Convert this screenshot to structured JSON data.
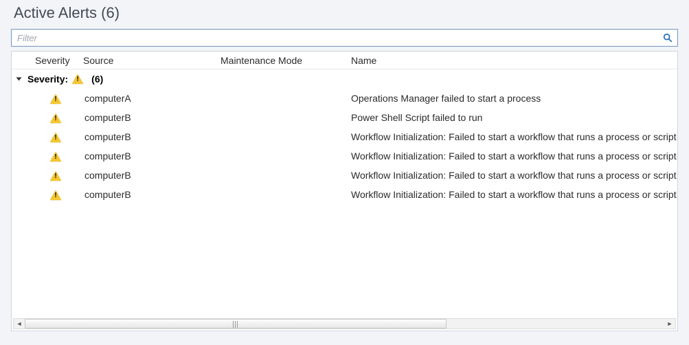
{
  "title_prefix": "Active Alerts",
  "title_count": "(6)",
  "filter_placeholder": "Filter",
  "columns": {
    "severity": "Severity",
    "source": "Source",
    "maintenance_mode": "Maintenance Mode",
    "name": "Name"
  },
  "group": {
    "label": "Severity:",
    "count": "(6)",
    "icon": "warning"
  },
  "rows": [
    {
      "icon": "warning",
      "source": "computerA",
      "maintenance_mode": "",
      "name": "Operations Manager failed to start a process"
    },
    {
      "icon": "warning",
      "source": "computerB",
      "maintenance_mode": "",
      "name": "Power Shell Script failed to run"
    },
    {
      "icon": "warning",
      "source": "computerB",
      "maintenance_mode": "",
      "name": "Workflow Initialization: Failed to start a workflow that runs a process or script"
    },
    {
      "icon": "warning",
      "source": "computerB",
      "maintenance_mode": "",
      "name": "Workflow Initialization: Failed to start a workflow that runs a process or script"
    },
    {
      "icon": "warning",
      "source": "computerB",
      "maintenance_mode": "",
      "name": "Workflow Initialization: Failed to start a workflow that runs a process or script"
    },
    {
      "icon": "warning",
      "source": "computerB",
      "maintenance_mode": "",
      "name": "Workflow Initialization: Failed to start a workflow that runs a process or script"
    }
  ]
}
